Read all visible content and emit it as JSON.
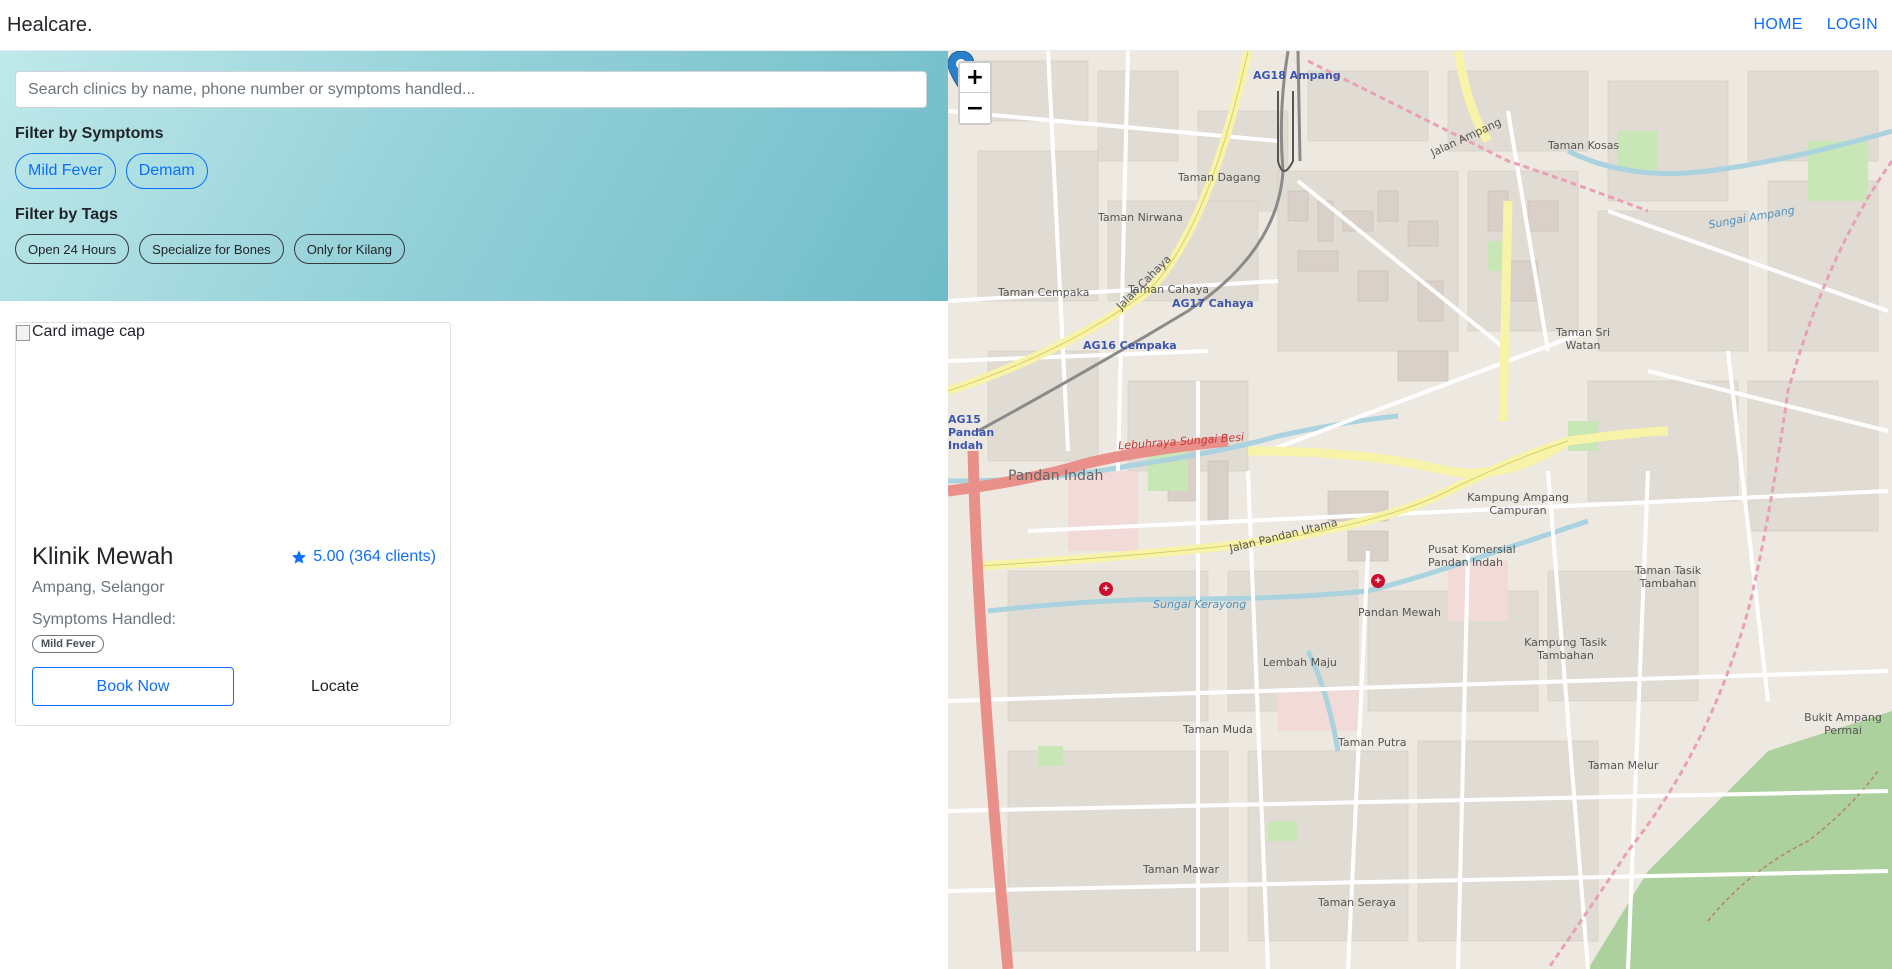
{
  "navbar": {
    "brand": "Healcare.",
    "links": [
      "HOME",
      "LOGIN"
    ]
  },
  "filters": {
    "search_placeholder": "Search clinics by name, phone number or symptoms handled...",
    "symptoms_title": "Filter by Symptoms",
    "symptoms": [
      "Mild Fever",
      "Demam"
    ],
    "tags_title": "Filter by Tags",
    "tags": [
      "Open 24 Hours",
      "Specialize for Bones",
      "Only for Kilang"
    ]
  },
  "card": {
    "image_alt": "Card image cap",
    "title": "Klinik Mewah",
    "rating": "5.00 (364 clients)",
    "location": "Ampang, Selangor",
    "symptoms_label": "Symptoms Handled:",
    "symptoms": [
      "Mild Fever"
    ],
    "book_label": "Book Now",
    "locate_label": "Locate"
  },
  "map": {
    "zoom_in": "+",
    "zoom_out": "−",
    "labels": {
      "ag18": "AG18 Ampang",
      "ag17": "AG17 Cahaya",
      "ag16": "AG16 Cempaka",
      "ag15": "AG15 Pandan Indah",
      "pandan_indah": "Pandan Indah",
      "pandan_mewah": "Pandan Mewah",
      "taman_nirwana": "Taman Nirwana",
      "taman_dagang": "Taman Dagang",
      "taman_cempaka": "Taman Cempaka",
      "taman_cahaya": "Taman Cahaya",
      "taman_kosas": "Taman Kosas",
      "lebuhraya": "Lebuhraya Sungai Besi",
      "jalan_pandan_utama": "Jalan Pandan Utama",
      "sungai_kerayong": "Sungai Kerayong",
      "kampung_ampang_campuran": "Kampung Ampang Campuran",
      "taman_putra": "Taman Putra",
      "taman_mawar": "Taman Mawar",
      "taman_muda": "Taman Muda",
      "lembah_maju": "Lembah Maju",
      "taman_seraya": "Taman Seraya",
      "taman_melur": "Taman Melur",
      "bukit_ampang": "Bukit Ampang Permai",
      "taman_sri_watan": "Taman Sri Watan",
      "jalan_ampang": "Jalan Ampang",
      "jalan_cahaya": "Jalan Cahaya",
      "kampung_tasik": "Kampung Tasik Tambahan",
      "taman_tasik": "Taman Tasik Tambahan",
      "sungai_ampang": "Sungai Ampang",
      "komersial": "Pusat Komersial Pandan Indah"
    }
  },
  "colors": {
    "primary": "#0d6efd",
    "panel_start": "#bfe9ea",
    "panel_end": "#6fbcc8",
    "road_yellow": "#f7f3a8",
    "road_red": "#e9908a",
    "water": "#aad3df",
    "park": "#c8e6b6",
    "marker": "#2a81cb"
  },
  "icons": {
    "rating": "star-icon",
    "marker": "map-marker-icon",
    "hospital": "hospital-icon"
  }
}
